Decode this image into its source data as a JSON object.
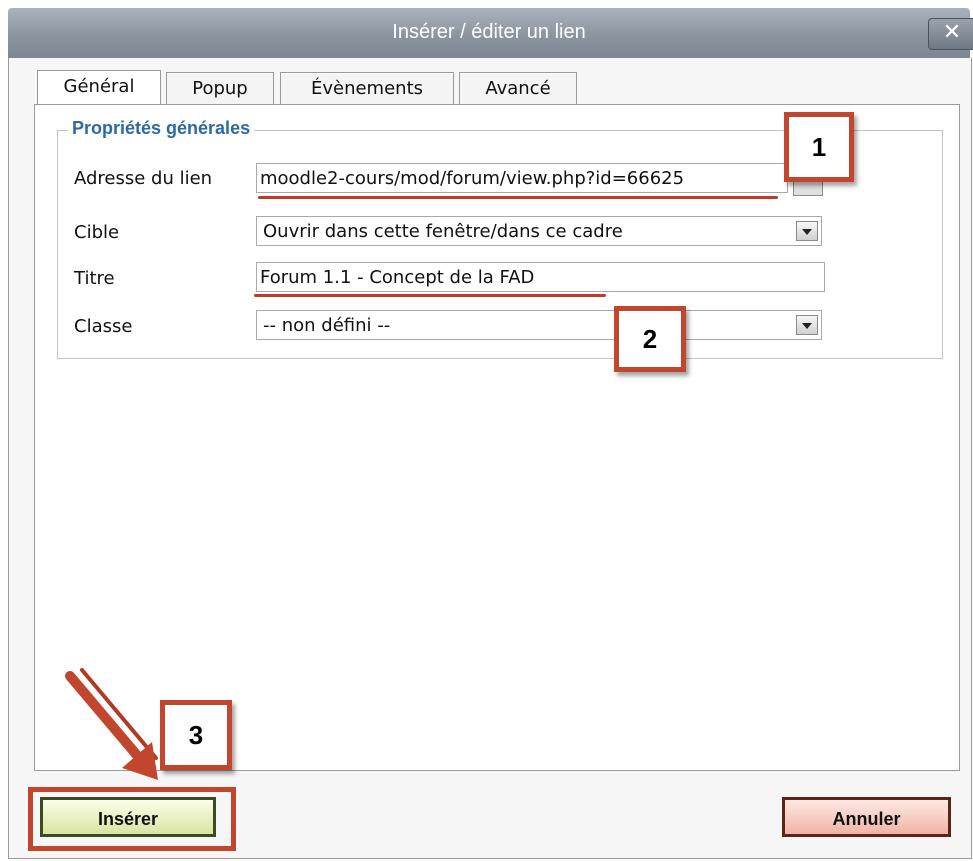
{
  "dialog": {
    "title": "Insérer / éditer un lien",
    "close_label": "✕"
  },
  "tabs": [
    {
      "label": "Général",
      "active": true
    },
    {
      "label": "Popup",
      "active": false
    },
    {
      "label": "Évènements",
      "active": false
    },
    {
      "label": "Avancé",
      "active": false
    }
  ],
  "general": {
    "legend": "Propriétés générales",
    "fields": {
      "link_address": {
        "label": "Adresse du lien",
        "value": "moodle2-cours/mod/forum/view.php?id=66625"
      },
      "target": {
        "label": "Cible",
        "value": "Ouvrir dans cette fenêtre/dans ce cadre"
      },
      "title": {
        "label": "Titre",
        "value": "Forum 1.1 - Concept de la FAD"
      },
      "class": {
        "label": "Classe",
        "value": "-- non défini --"
      }
    }
  },
  "callouts": {
    "one": "1",
    "two": "2",
    "three": "3"
  },
  "buttons": {
    "insert": "Insérer",
    "cancel": "Annuler"
  },
  "colors": {
    "annotation": "#c2452e",
    "legend": "#2b6aa6"
  }
}
